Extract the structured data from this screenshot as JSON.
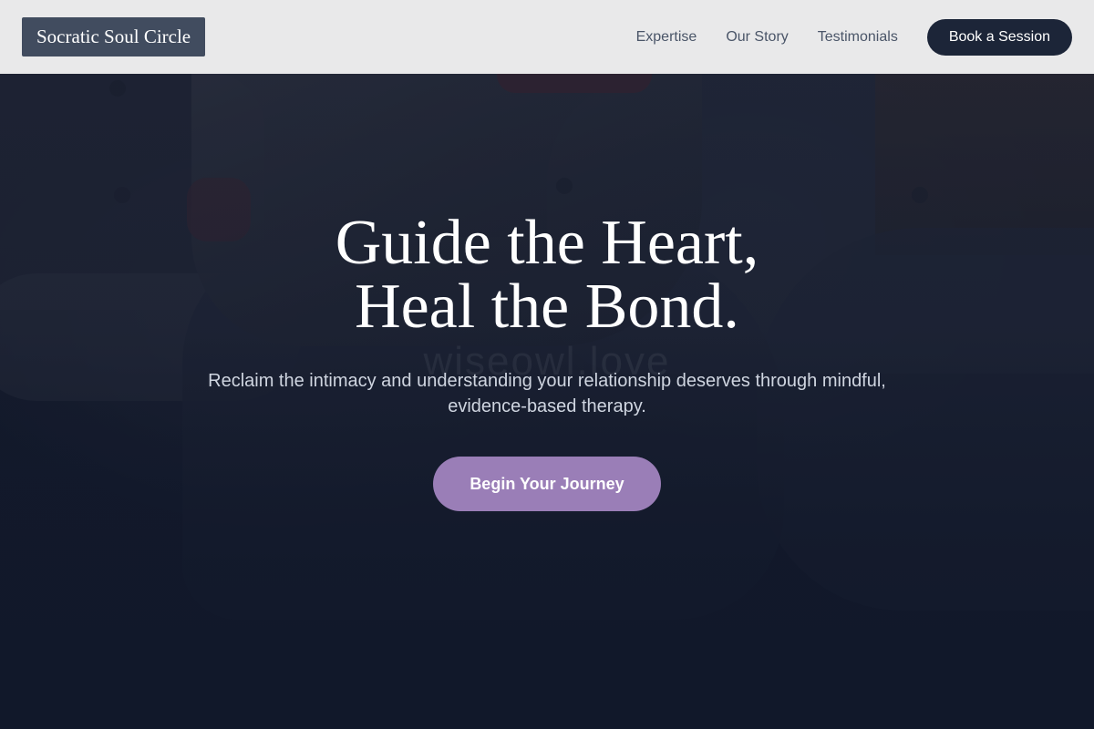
{
  "header": {
    "logo": "Socratic Soul Circle",
    "nav": [
      {
        "label": "Expertise"
      },
      {
        "label": "Our Story"
      },
      {
        "label": "Testimonials"
      }
    ],
    "cta_label": "Book a Session"
  },
  "hero": {
    "headline_line1": "Guide the Heart,",
    "headline_line2": "Heal the Bond.",
    "subtitle": "Reclaim the intimacy and understanding your relationship deserves through mindful, evidence-based therapy.",
    "cta_label": "Begin Your Journey",
    "watermark": "wiseowl.love"
  },
  "colors": {
    "header_bg": "#e9e9ea",
    "logo_bg": "#414c5f",
    "nav_text": "#4a5568",
    "dark_button": "#1c2538",
    "accent_purple": "#9a7eb7",
    "hero_overlay": "#121a2e"
  }
}
